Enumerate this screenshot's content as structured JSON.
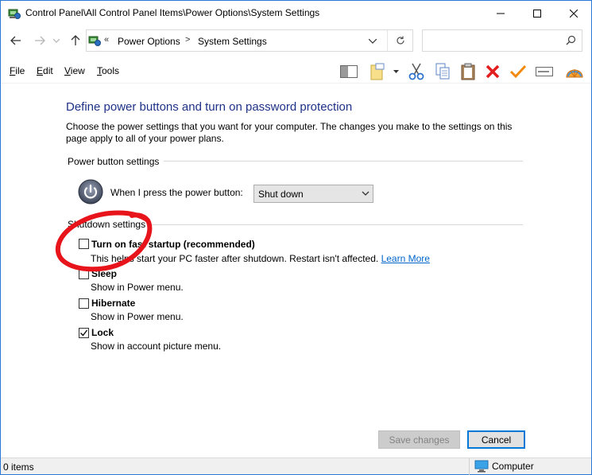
{
  "window": {
    "title": "Control Panel\\All Control Panel Items\\Power Options\\System Settings",
    "minimize_icon": "minimize-icon",
    "maximize_icon": "maximize-icon",
    "close_icon": "close-icon"
  },
  "address": {
    "chevron": "«",
    "crumbs": [
      "Power Options",
      "System Settings"
    ],
    "separator": ">",
    "search_placeholder": ""
  },
  "menu": {
    "items": [
      {
        "label": "File",
        "underline": "F",
        "rest": "ile"
      },
      {
        "label": "Edit",
        "underline": "E",
        "rest": "dit"
      },
      {
        "label": "View",
        "underline": "V",
        "rest": "iew"
      },
      {
        "label": "Tools",
        "underline": "T",
        "rest": "ools"
      }
    ]
  },
  "content": {
    "heading": "Define power buttons and turn on password protection",
    "description": "Choose the power settings that you want for your computer. The changes you make to the settings on this page apply to all of your power plans.",
    "power_group_label": "Power button settings",
    "power_button_label": "When I press the power button:",
    "power_button_value": "Shut down",
    "shutdown_group_label": "Shutdown settings",
    "options": [
      {
        "label": "Turn on fast startup (recommended)",
        "desc": "This helps start your PC faster after shutdown. Restart isn't affected.",
        "link": "Learn More",
        "checked": false
      },
      {
        "label": "Sleep",
        "desc": "Show in Power menu.",
        "checked": false
      },
      {
        "label": "Hibernate",
        "desc": "Show in Power menu.",
        "checked": false
      },
      {
        "label": "Lock",
        "desc": "Show in account picture menu.",
        "checked": true
      }
    ]
  },
  "buttons": {
    "save": "Save changes",
    "cancel": "Cancel"
  },
  "status": {
    "items": "0 items",
    "location": "Computer"
  },
  "colors": {
    "heading": "#1e3287",
    "link": "#0066cc",
    "annotation": "#e8141b",
    "accent": "#0078d7"
  }
}
